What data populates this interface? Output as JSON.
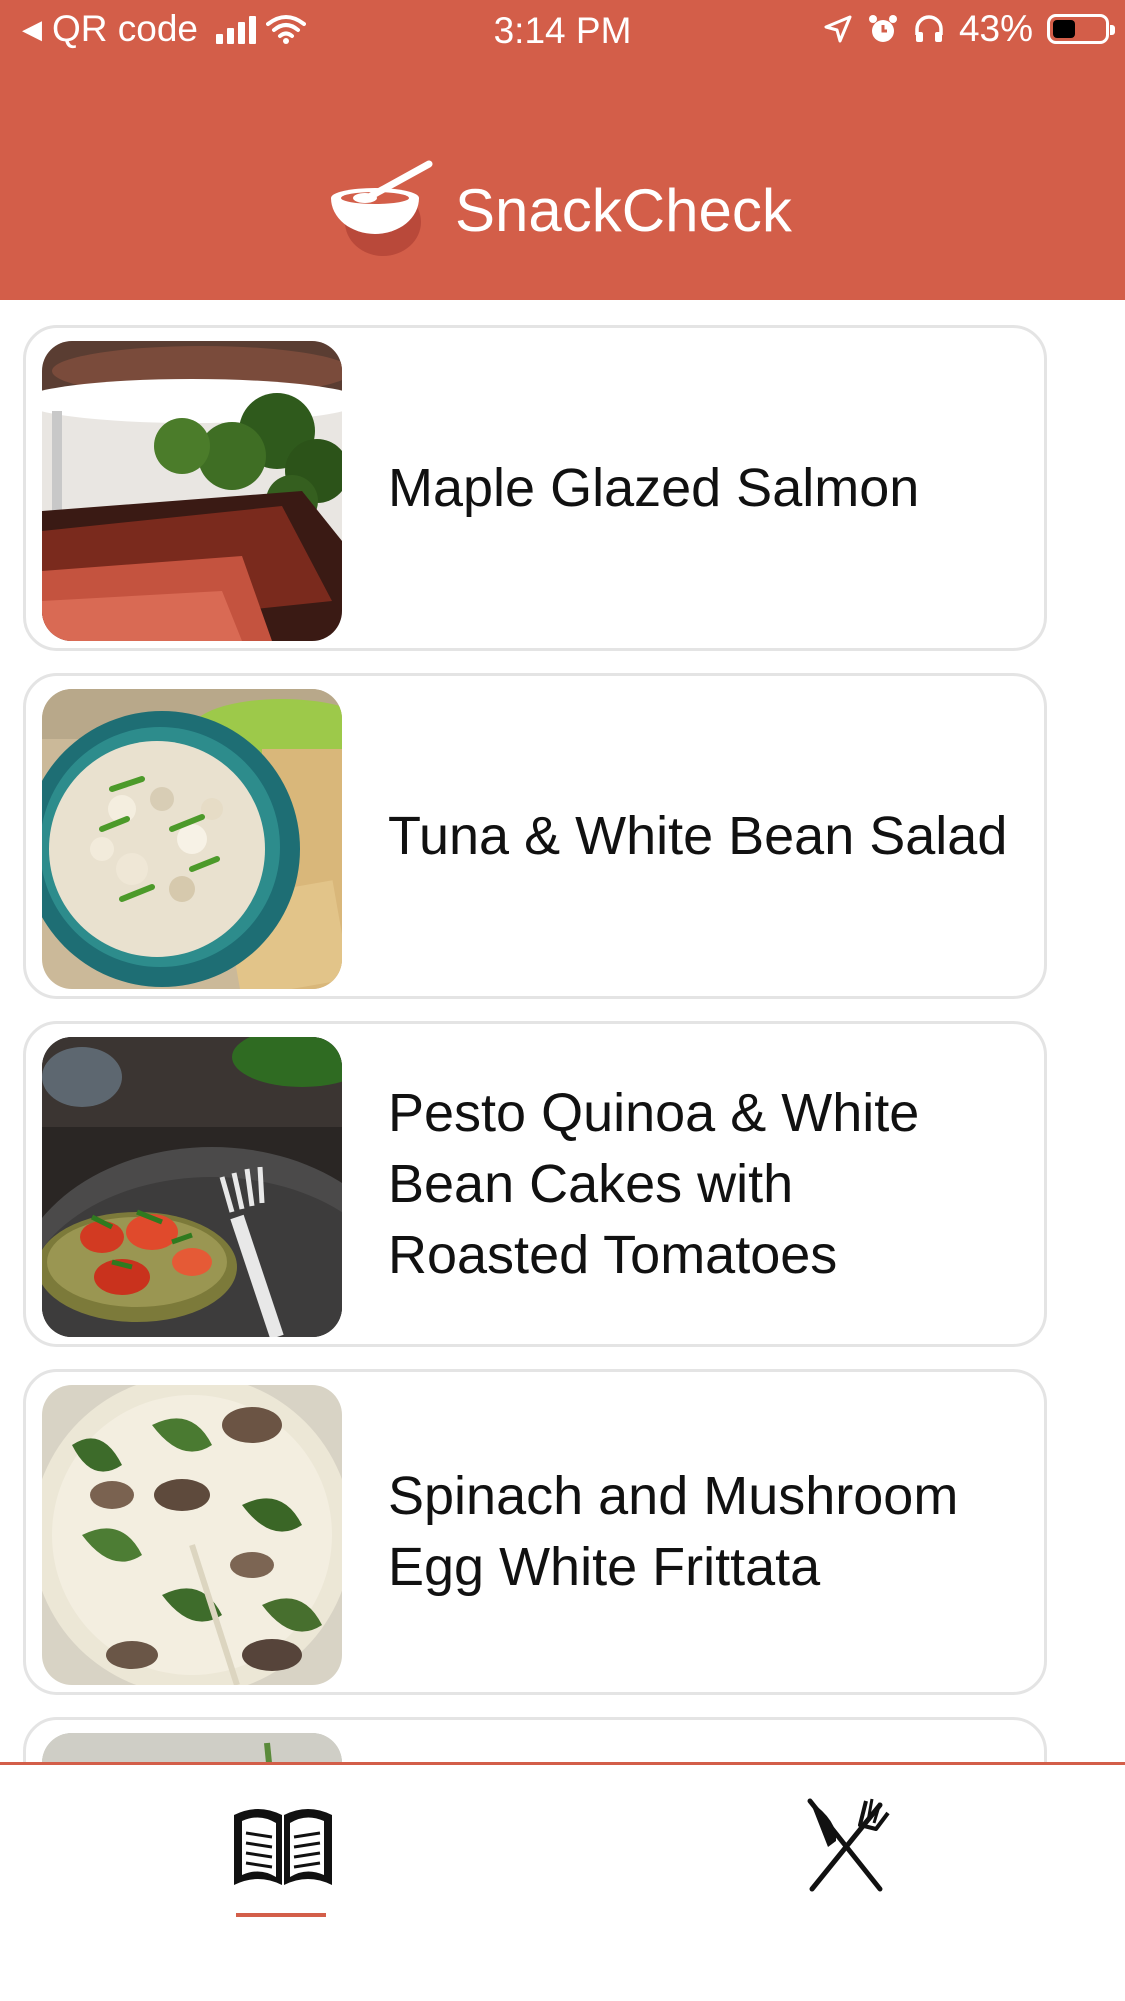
{
  "status_bar": {
    "back_label": "QR code",
    "time": "3:14 PM",
    "battery": "43%",
    "battery_level": 0.43
  },
  "header": {
    "app_name": "SnackCheck",
    "logo_icon": "bowl-spoon-icon",
    "background_color": "#d35e49"
  },
  "recipes": [
    {
      "title": "Maple Glazed Salmon",
      "image": "salmon-photo"
    },
    {
      "title": "Tuna & White Bean Salad",
      "image": "tuna-salad-photo"
    },
    {
      "title": "Pesto Quinoa & White\nBean Cakes with\nRoasted Tomatoes",
      "image": "quinoa-cakes-photo"
    },
    {
      "title": "Spinach and Mushroom\nEgg White Frittata",
      "image": "frittata-photo"
    },
    {
      "title": "",
      "image": "partial-photo"
    }
  ],
  "tabbar": {
    "tabs": [
      {
        "name": "recipes",
        "icon": "open-book-icon",
        "selected": true
      },
      {
        "name": "dining",
        "icon": "knife-fork-icon",
        "selected": false
      }
    ],
    "accent_color": "#d35e49"
  }
}
